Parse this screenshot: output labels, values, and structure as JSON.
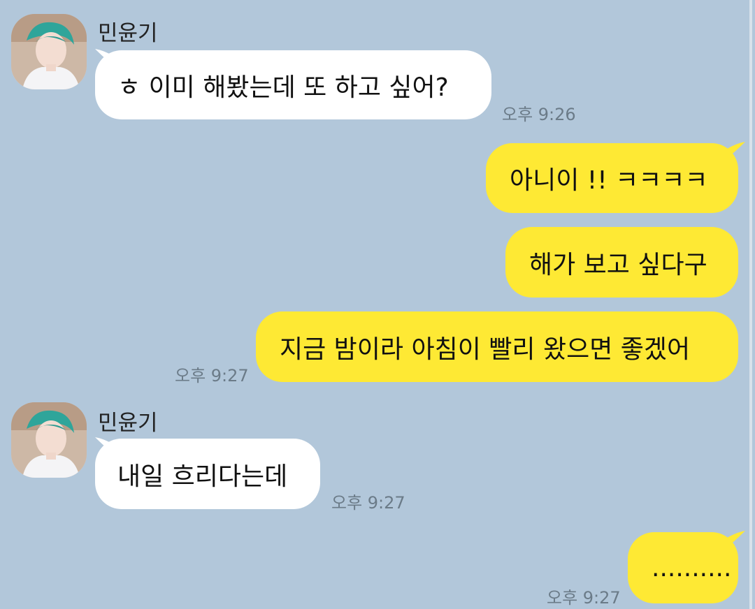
{
  "chat": {
    "messages": [
      {
        "from": "민윤기",
        "sender": "민윤기",
        "text": "ㅎ 이미 해봤는데 또 하고 싶어?",
        "time": "오후 9:26"
      },
      {
        "from": "me",
        "text": "아니이 !! ㅋㅋㅋㅋ"
      },
      {
        "from": "me",
        "text": "해가 보고 싶다구"
      },
      {
        "from": "me",
        "text": "지금 밤이라 아침이 빨리 왔으면 좋겠어",
        "time": "오후 9:27"
      },
      {
        "from": "민윤기",
        "sender": "민윤기",
        "text": "내일 흐리다는데",
        "time": "오후 9:27"
      },
      {
        "from": "me",
        "text": "..........",
        "time": "오후 9:27"
      }
    ]
  },
  "colors": {
    "background": "#b2c7da",
    "incoming_bubble": "#ffffff",
    "outgoing_bubble": "#fee934",
    "timestamp": "#6b7b88"
  },
  "icons": {
    "avatar": "profile-photo-green-hair"
  }
}
